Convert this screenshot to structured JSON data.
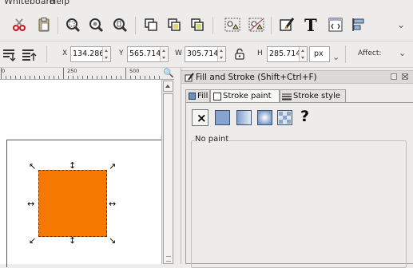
{
  "menu": {
    "items": [
      "Whiteboard",
      "Help"
    ]
  },
  "commands_toolbar": {
    "icons": [
      "cut-icon",
      "paste-icon",
      "zoom-selection-icon",
      "zoom-drawing-icon",
      "zoom-page-icon",
      "duplicate-icon",
      "clone-icon",
      "unlink-clone-icon",
      "group-icon",
      "ungroup-icon",
      "fill-stroke-icon",
      "text-tool-icon",
      "xml-editor-icon",
      "align-icon"
    ]
  },
  "controls_toolbar": {
    "x_label": "X",
    "x_value": "134.286",
    "y_label": "Y",
    "y_value": "565.714",
    "w_label": "W",
    "w_value": "305.714",
    "h_label": "H",
    "h_value": "285.714",
    "unit": "px",
    "affect_label": "Affect:"
  },
  "ruler": {
    "labels": [
      "0",
      "250",
      "500"
    ]
  },
  "canvas": {
    "object_color": "#f57900"
  },
  "dialog": {
    "title": "Fill and Stroke (Shift+Ctrl+F)",
    "tabs": [
      {
        "label": "Fill",
        "active": false
      },
      {
        "label": "Stroke paint",
        "active": true
      },
      {
        "label": "Stroke style",
        "active": false
      }
    ],
    "paint_types": [
      "no-paint",
      "flat-color",
      "linear-gradient",
      "radial-gradient",
      "pattern",
      "unset"
    ],
    "unset_glyph": "?",
    "no_paint_glyph": "×",
    "section_label": "No paint"
  }
}
